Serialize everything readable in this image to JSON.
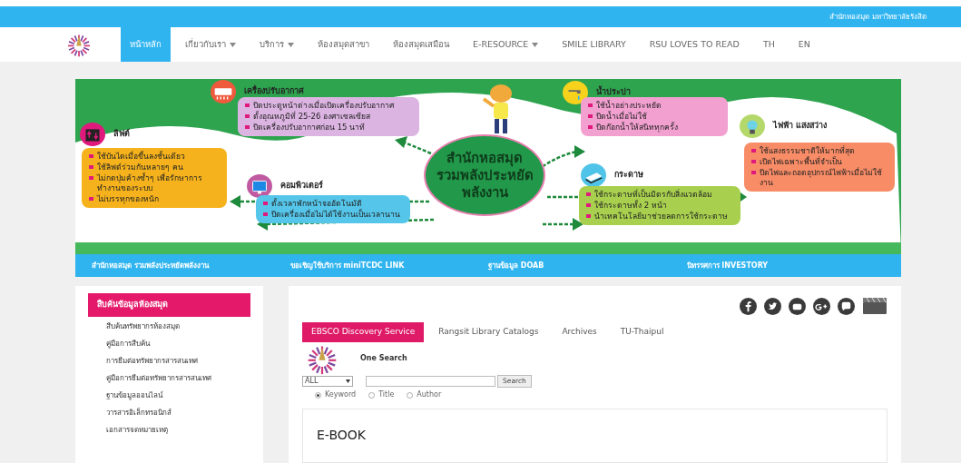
{
  "top_bar": {
    "title": "สำนักหอสมุด มหาวิทยาลัยรังสิต"
  },
  "nav": {
    "items": [
      {
        "label": "หน้าหลัก",
        "selected": true,
        "dropdown": false
      },
      {
        "label": "เกี่ยวกับเรา",
        "selected": false,
        "dropdown": true
      },
      {
        "label": "บริการ",
        "selected": false,
        "dropdown": true
      },
      {
        "label": "ห้องสมุดสาขา",
        "selected": false,
        "dropdown": false
      },
      {
        "label": "ห้องสมุดเสมือน",
        "selected": false,
        "dropdown": false
      },
      {
        "label": "E-RESOURCE",
        "selected": false,
        "dropdown": true
      },
      {
        "label": "SMILE LIBRARY",
        "selected": false,
        "dropdown": false
      },
      {
        "label": "RSU LOVES TO READ",
        "selected": false,
        "dropdown": false
      },
      {
        "label": "TH",
        "selected": false,
        "dropdown": false
      },
      {
        "label": "EN",
        "selected": false,
        "dropdown": false
      }
    ]
  },
  "banner": {
    "title_lines": [
      "สำนักหอสมุด",
      "รวมพลังประหยัด",
      "พลังงาน"
    ],
    "topics": [
      {
        "kind": "lift",
        "title": "ลิฟต์",
        "color": "#f5b21c",
        "tips": [
          "ใช้บันไดเมื่อขึ้นลงชั้นเดียว",
          "ใช้ลิฟต์ร่วมกันหลายๆ คน",
          "ไม่กดปุ่มค้างซ้ำๆ เพื่อรักษาการทำงานของระบบ",
          "ไม่บรรทุกของหนัก"
        ]
      },
      {
        "kind": "air",
        "title": "เครื่องปรับอากาศ",
        "color": "#dcb4e2",
        "tips": [
          "ปิดประตูหน้าต่างเมื่อเปิดเครื่องปรับอากาศ",
          "ตั้งอุณหภูมิที่ 25-26 องศาเซลเซียส",
          "ปิดเครื่องปรับอากาศก่อน 15 นาที"
        ]
      },
      {
        "kind": "computer",
        "title": "คอมพิวเตอร์",
        "color": "#55c6ea",
        "tips": [
          "ตั้งเวลาพักหน้าจออัตโนมัติ",
          "ปิดเครื่องเมื่อไม่ได้ใช้งานเป็นเวลานาน"
        ]
      },
      {
        "kind": "water",
        "title": "น้ำประปา",
        "color": "#f2a0d0",
        "tips": [
          "ใช้น้ำอย่างประหยัด",
          "ปิดน้ำเมื่อไม่ใช้",
          "ปิดก๊อกน้ำให้สนิททุกครั้ง"
        ]
      },
      {
        "kind": "paper",
        "title": "กระดาษ",
        "color": "#a8d04e",
        "tips": [
          "ใช้กระดาษที่เป็นมิตรกับสิ่งแวดล้อม",
          "ใช้กระดาษทั้ง 2 หน้า",
          "นำเทคโนโลยีมาช่วยลดการใช้กระดาษ"
        ]
      },
      {
        "kind": "light",
        "title": "ไฟฟ้า แสงสว่าง",
        "color": "#f88c66",
        "tips": [
          "ใช้แสงธรรมชาติให้มากที่สุด",
          "เปิดไฟเฉพาะพื้นที่จำเป็น",
          "ปิดไฟและถอดอุปกรณ์ไฟฟ้าเมื่อไม่ใช้งาน"
        ]
      }
    ]
  },
  "link_bar": [
    "สำนักหอสมุด รวมพลังประหยัดพลังงาน",
    "ขอเชิญใช้บริการ miniTCDC LINK",
    "ฐานข้อมูล DOAB",
    "นิทรรศการ INVESTORY"
  ],
  "sidebar": {
    "heading": "สืบค้นข้อมูลห้องสมุด",
    "items": [
      "สืบค้นทรัพยากรห้องสมุด",
      "คู่มือการสืบค้น",
      "การยืมต่อทรัพยากรสารสนเทศ",
      "คู่มือการยืมต่อทรัพยากรสารสนเทศ",
      "ฐานข้อมูลออนไลน์",
      "วารสารอิเล็กทรอนิกส์",
      "เอกสารจดหมายเหตุ"
    ]
  },
  "search_tabs": [
    {
      "label": "EBSCO Discovery Service",
      "selected": true
    },
    {
      "label": "Rangsit Library Catalogs",
      "selected": false
    },
    {
      "label": "Archives",
      "selected": false
    },
    {
      "label": "TU-Thaipul",
      "selected": false
    }
  ],
  "search": {
    "title": "One Search",
    "scope": "ALL",
    "button": "Search",
    "options": [
      {
        "label": "Keyword",
        "selected": true
      },
      {
        "label": "Title",
        "selected": false
      },
      {
        "label": "Author",
        "selected": false
      }
    ]
  },
  "card": {
    "title": "E-BOOK"
  }
}
